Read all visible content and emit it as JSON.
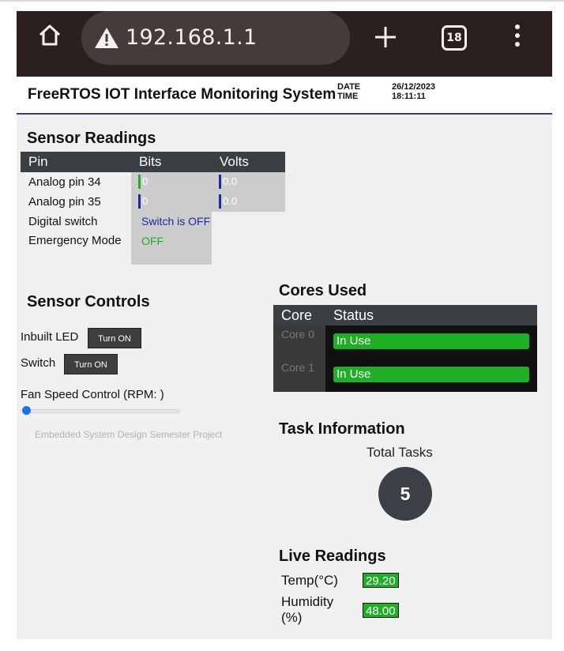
{
  "browser": {
    "url": "192.168.1.1",
    "tab_count": "18"
  },
  "header": {
    "title": "FreeRTOS IOT Interface Monitoring System",
    "date_label": "DATE",
    "time_label": "TIME",
    "date_value": "26/12/2023",
    "time_value": "18:11:11"
  },
  "sensor_readings": {
    "heading": "Sensor Readings",
    "columns": [
      "Pin",
      "Bits",
      "Volts"
    ],
    "rows": [
      {
        "label": "Analog pin 34",
        "bits": "0",
        "volts": "0.0",
        "bits_color": "#1faf25",
        "volts_color": "#1c2a9c"
      },
      {
        "label": "Analog pin 35",
        "bits": "0",
        "volts": "0.0",
        "bits_color": "#1c2a9c",
        "volts_color": "#1c2a9c"
      },
      {
        "label": "Digital switch",
        "bits": "Switch is OFF",
        "bits_color": "#1c2a9c"
      },
      {
        "label": "Emergency Mode",
        "bits": "OFF",
        "bits_color": "#1faf25"
      }
    ]
  },
  "sensor_controls": {
    "heading": "Sensor Controls",
    "led_label": "Inbuilt LED",
    "led_button": "Turn ON",
    "switch_label": "Switch",
    "switch_button": "Turn ON",
    "fan_label": "Fan Speed Control (RPM: )",
    "fan_level": 0,
    "footer": "Embedded System Design Semester Project"
  },
  "cores_used": {
    "heading": "Cores Used",
    "columns": [
      "Core",
      "Status"
    ],
    "rows": [
      {
        "core": "Core 0",
        "status": "In Use"
      },
      {
        "core": "Core 1",
        "status": "In Use"
      }
    ]
  },
  "task_information": {
    "heading": "Task Information",
    "total_label": "Total Tasks",
    "total_value": "5"
  },
  "live_readings": {
    "heading": "Live Readings",
    "temp_label": "Temp(°C)",
    "temp_value": "29.20",
    "humidity_label": "Humidity (%)",
    "humidity_value": "48.00"
  },
  "colors": {
    "accent_green": "#1faf25",
    "bar_blue": "#1c2a9c",
    "table_header": "#3a3f44",
    "header_rule": "#333f7a"
  }
}
